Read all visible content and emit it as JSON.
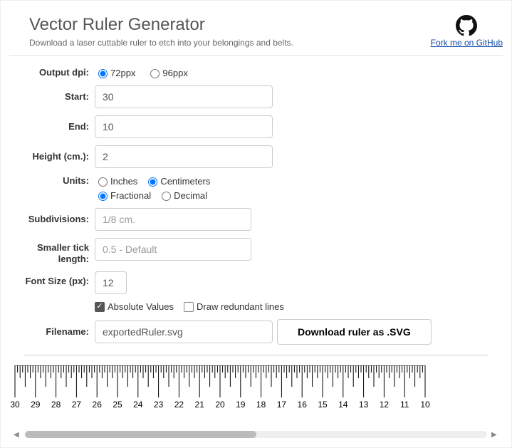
{
  "header": {
    "title": "Vector Ruler Generator",
    "subtitle": "Download a laser cuttable ruler to etch into your belongings and belts.",
    "github_link": "Fork me on GitHub"
  },
  "form": {
    "dpi": {
      "label": "Output dpi:",
      "options": [
        "72ppx",
        "96ppx"
      ],
      "selected": "72ppx"
    },
    "start": {
      "label": "Start:",
      "value": "30"
    },
    "end": {
      "label": "End:",
      "value": "10"
    },
    "height": {
      "label": "Height (cm.):",
      "value": "2"
    },
    "units": {
      "label": "Units:",
      "system": {
        "options": [
          "Inches",
          "Centimeters"
        ],
        "selected": "Centimeters"
      },
      "format": {
        "options": [
          "Fractional",
          "Decimal"
        ],
        "selected": "Fractional"
      }
    },
    "subdivisions": {
      "label": "Subdivisions:",
      "placeholder": "1/8 cm."
    },
    "ticklen": {
      "label": "Smaller tick length:",
      "placeholder": "0.5 - Default"
    },
    "fontsize": {
      "label": "Font Size (px):",
      "value": "12"
    },
    "absolute_values": {
      "label": "Absolute Values",
      "checked": true
    },
    "redundant_lines": {
      "label": "Draw redundant lines",
      "checked": false
    },
    "filename": {
      "label": "Filename:",
      "value": "exportedRuler.svg"
    },
    "download_button": "Download ruler as .SVG"
  },
  "ruler": {
    "labels": [
      "30",
      "29",
      "28",
      "27",
      "26",
      "25",
      "24",
      "23",
      "22",
      "21",
      "20",
      "19",
      "18",
      "17",
      "16",
      "15",
      "14",
      "13",
      "12",
      "11",
      "10"
    ]
  }
}
